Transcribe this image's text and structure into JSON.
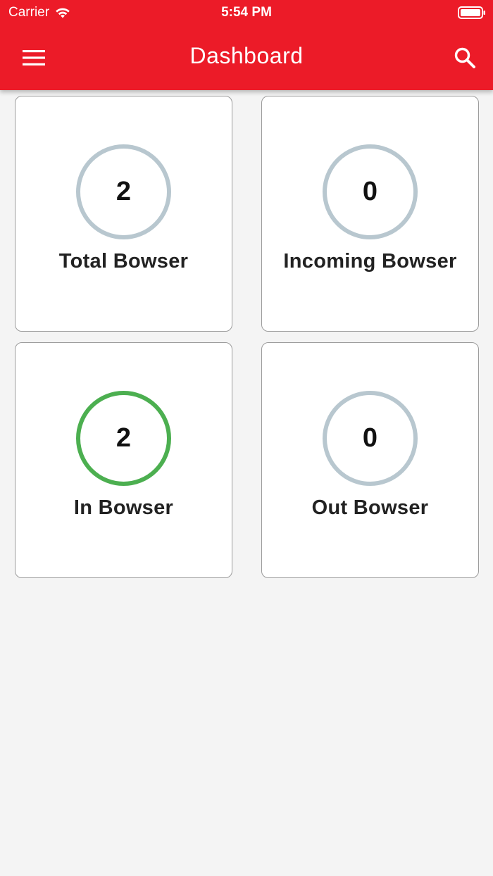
{
  "status_bar": {
    "carrier": "Carrier",
    "time": "5:54 PM",
    "icons": [
      "wifi-icon",
      "battery-icon"
    ]
  },
  "appbar": {
    "title": "Dashboard",
    "left_icon": "hamburger-menu-icon",
    "right_icon": "search-icon",
    "color": "#ec1b28"
  },
  "cards": [
    {
      "label": "Total Bowser",
      "value": "2",
      "ring_color": "#b8c7cf"
    },
    {
      "label": "Incoming Bowser",
      "value": "0",
      "ring_color": "#b8c7cf"
    },
    {
      "label": "In Bowser",
      "value": "2",
      "ring_color": "#4caf50"
    },
    {
      "label": "Out Bowser",
      "value": "0",
      "ring_color": "#b8c7cf"
    }
  ]
}
